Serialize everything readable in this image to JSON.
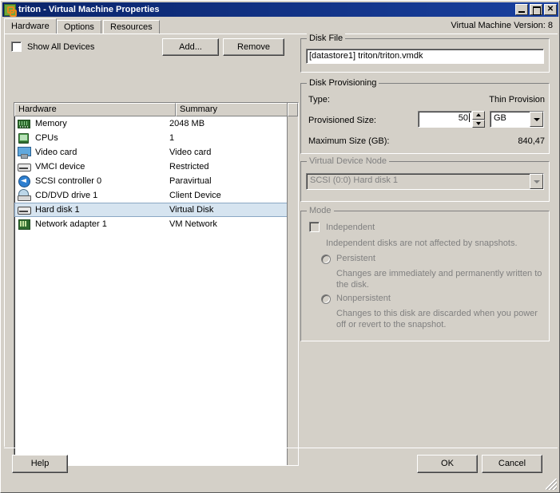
{
  "window": {
    "title": "triton - Virtual Machine Properties",
    "icon": "vm-icon",
    "buttons": {
      "minimize": "_",
      "maximize": "",
      "close": "✕"
    }
  },
  "version_label": "Virtual Machine Version: 8",
  "tabs": [
    {
      "label": "Hardware",
      "active": true
    },
    {
      "label": "Options",
      "active": false
    },
    {
      "label": "Resources",
      "active": false
    }
  ],
  "left_pane": {
    "show_all_devices": {
      "label": "Show All Devices",
      "checked": false
    },
    "add_button": "Add...",
    "remove_button": "Remove",
    "columns": [
      "Hardware",
      "Summary"
    ],
    "rows": [
      {
        "icon": "memory-icon",
        "name": "Memory",
        "summary": "2048 MB",
        "selected": false
      },
      {
        "icon": "cpu-icon",
        "name": "CPUs",
        "summary": "1",
        "selected": false
      },
      {
        "icon": "video-icon",
        "name": "Video card",
        "summary": "Video card",
        "selected": false
      },
      {
        "icon": "vmci-icon",
        "name": "VMCI device",
        "summary": "Restricted",
        "selected": false
      },
      {
        "icon": "scsi-icon",
        "name": "SCSI controller 0",
        "summary": "Paravirtual",
        "selected": false
      },
      {
        "icon": "cddvd-icon",
        "name": "CD/DVD drive 1",
        "summary": "Client Device",
        "selected": false
      },
      {
        "icon": "harddisk-icon",
        "name": "Hard disk 1",
        "summary": "Virtual Disk",
        "selected": true
      },
      {
        "icon": "network-icon",
        "name": "Network adapter 1",
        "summary": "VM Network",
        "selected": false
      }
    ]
  },
  "right_pane": {
    "disk_file": {
      "legend": "Disk File",
      "value": "[datastore1] triton/triton.vmdk"
    },
    "disk_provisioning": {
      "legend": "Disk Provisioning",
      "type_label": "Type:",
      "type_value": "Thin Provision",
      "provisioned_size_label": "Provisioned Size:",
      "provisioned_size_value": "50",
      "units_value": "GB",
      "maximum_size_label": "Maximum Size (GB):",
      "maximum_size_value": "840,47"
    },
    "virtual_device_node": {
      "legend": "Virtual Device Node",
      "value": "SCSI (0:0) Hard disk 1",
      "disabled": true
    },
    "mode": {
      "legend": "Mode",
      "disabled": true,
      "independent_label": "Independent",
      "independent_checked": false,
      "independent_desc": "Independent disks are not affected by snapshots.",
      "persistent_label": "Persistent",
      "persistent_desc": "Changes are immediately and permanently written to the disk.",
      "nonpersistent_label": "Nonpersistent",
      "nonpersistent_desc": "Changes to this disk are discarded when you power off or revert to the snapshot."
    }
  },
  "footer": {
    "help_label": "Help",
    "ok_label": "OK",
    "cancel_label": "Cancel"
  },
  "colors": {
    "title_bar_start": "#0a246a",
    "title_bar_end": "#19409f",
    "face": "#d4d0c8",
    "selection": "#d6e4f0",
    "selection_border": "#8ba7c4",
    "disabled_text": "#808080"
  }
}
